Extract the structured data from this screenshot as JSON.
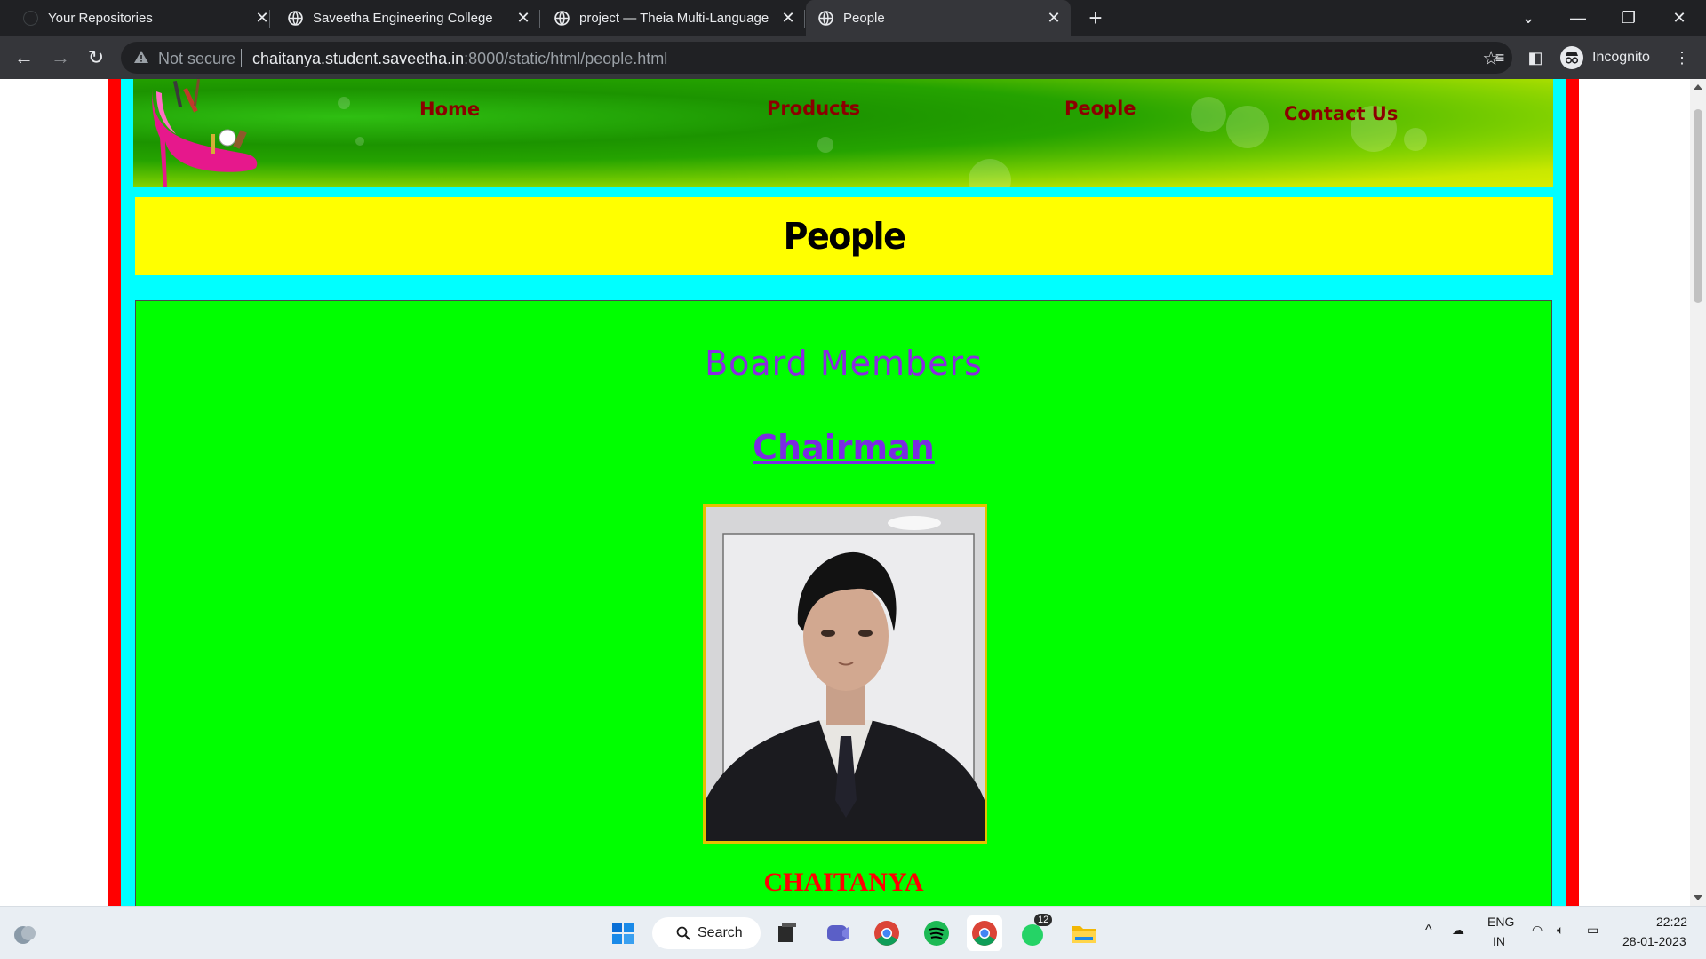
{
  "browser": {
    "tabs": [
      {
        "title": "Your Repositories",
        "active": false
      },
      {
        "title": "Saveetha Engineering College",
        "active": false
      },
      {
        "title": "project — Theia Multi-Language",
        "active": false
      },
      {
        "title": "People",
        "active": true
      }
    ],
    "address": {
      "security_label": "Not secure",
      "host": "chaitanya.student.saveetha.in",
      "rest": ":8000/static/html/people.html"
    },
    "profile_label": "Incognito"
  },
  "page": {
    "nav": {
      "home": "Home",
      "products": "Products",
      "people": "People",
      "contact": "Contact Us"
    },
    "title": "People",
    "section_heading": "Board Members",
    "role_link": "Chairman",
    "person_name": "CHAITANYA"
  },
  "taskbar": {
    "search_label": "Search",
    "whatsapp_badge": "12",
    "lang_line1": "ENG",
    "lang_line2": "IN",
    "time": "22:22",
    "date": "28-01-2023"
  },
  "colors": {
    "frame_red": "#ff0000",
    "frame_cyan": "#00ffff",
    "title_band": "#ffff00",
    "content_green": "#00ff00",
    "nav_text": "#8b0000",
    "heading_purple": "#8a2be2",
    "name_red": "#ff0000"
  }
}
